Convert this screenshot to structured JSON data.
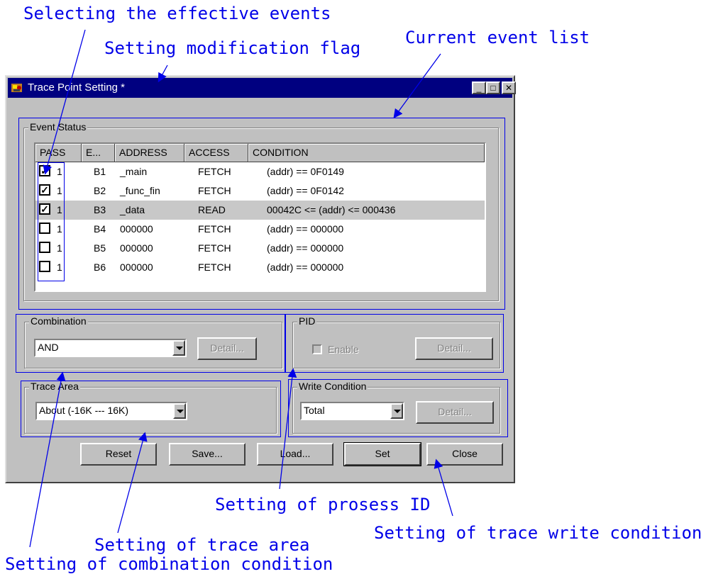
{
  "annotations": {
    "selecting_events": "Selecting the effective events",
    "modification_flag": "Setting modification flag",
    "current_event_list": "Current event list",
    "process_id": "Setting of prosess ID",
    "trace_area": "Setting of trace area",
    "write_condition": "Setting of trace write condition",
    "combination": "Setting of combination condition"
  },
  "window": {
    "title": "Trace Point Setting *",
    "minimize_label": "_",
    "maximize_label": "□",
    "close_label": "✕"
  },
  "event_status": {
    "label": "Event Status",
    "columns": [
      "PASS",
      "E...",
      "ADDRESS",
      "ACCESS",
      "CONDITION"
    ],
    "rows": [
      {
        "checked": true,
        "pass": "1",
        "event": "B1",
        "address": "_main",
        "access": "FETCH",
        "condition": "(addr) == 0F0149",
        "selected": false
      },
      {
        "checked": true,
        "pass": "1",
        "event": "B2",
        "address": "_func_fin",
        "access": "FETCH",
        "condition": "(addr) == 0F0142",
        "selected": false
      },
      {
        "checked": true,
        "pass": "1",
        "event": "B3",
        "address": "_data",
        "access": "READ",
        "condition": "00042C <= (addr) <= 000436",
        "selected": true
      },
      {
        "checked": false,
        "pass": "1",
        "event": "B4",
        "address": "000000",
        "access": "FETCH",
        "condition": "(addr) == 000000",
        "selected": false
      },
      {
        "checked": false,
        "pass": "1",
        "event": "B5",
        "address": "000000",
        "access": "FETCH",
        "condition": "(addr) == 000000",
        "selected": false
      },
      {
        "checked": false,
        "pass": "1",
        "event": "B6",
        "address": "000000",
        "access": "FETCH",
        "condition": "(addr) == 000000",
        "selected": false
      }
    ]
  },
  "combination": {
    "label": "Combination",
    "value": "AND",
    "detail_label": "Detail..."
  },
  "pid": {
    "label": "PID",
    "enable_label": "Enable",
    "detail_label": "Detail..."
  },
  "trace_area": {
    "label": "Trace Area",
    "value": "About (-16K --- 16K)"
  },
  "write_condition": {
    "label": "Write Condition",
    "value": "Total",
    "detail_label": "Detail..."
  },
  "buttons": {
    "reset": "Reset",
    "save": "Save...",
    "load": "Load...",
    "set": "Set",
    "close": "Close"
  },
  "colors": {
    "annotation": "#0000e8",
    "titlebar": "#000080",
    "face": "#c0c0c0",
    "selected_row": "#c8c8c8"
  }
}
